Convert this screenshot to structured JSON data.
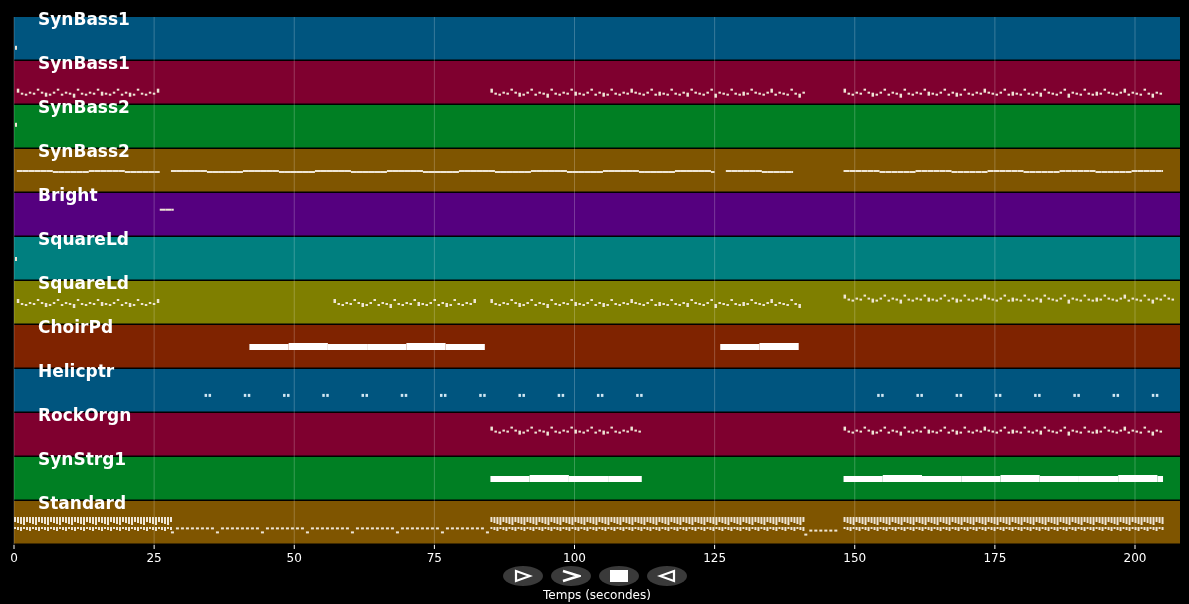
{
  "tracks": [
    {
      "name": "SynBass1",
      "color": "#00557f"
    },
    {
      "name": "SynBass1",
      "color": "#7f002f"
    },
    {
      "name": "SynBass2",
      "color": "#007f23"
    },
    {
      "name": "SynBass2",
      "color": "#7f5500"
    },
    {
      "name": "Bright",
      "color": "#55007f"
    },
    {
      "name": "SquareLd",
      "color": "#007f7f"
    },
    {
      "name": "SquareLd",
      "color": "#7f7f00"
    },
    {
      "name": "ChoirPd",
      "color": "#7f2300"
    },
    {
      "name": "Helicptr",
      "color": "#00557f"
    },
    {
      "name": "RockOrgn",
      "color": "#7f002f"
    },
    {
      "name": "SynStrg1",
      "color": "#007f23"
    },
    {
      "name": "Standard",
      "color": "#7f5500"
    }
  ],
  "x_axis": {
    "title": "Temps (secondes)",
    "ticks": [
      "0",
      "25",
      "50",
      "75",
      "100",
      "125",
      "150",
      "175",
      "200"
    ]
  },
  "controls": [
    {
      "kind": "play"
    },
    {
      "kind": "next"
    },
    {
      "kind": "stop"
    },
    {
      "kind": "reverse"
    }
  ]
}
